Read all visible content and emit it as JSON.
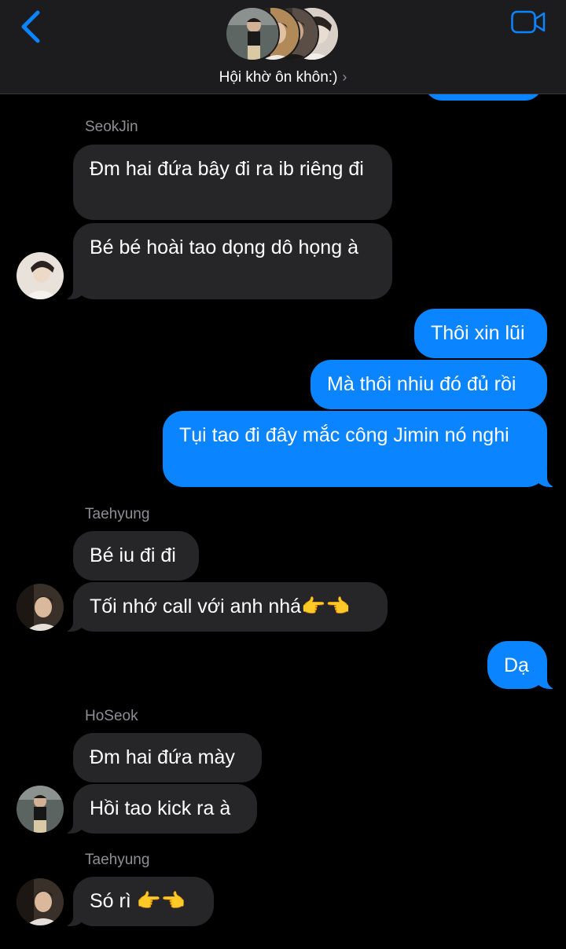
{
  "header": {
    "title": "Hội khờ ôn khôn:)",
    "chevron": "›"
  },
  "icons": {
    "back": "chevron-left-icon",
    "video": "video-camera-icon",
    "accent": "#0a84ff"
  },
  "messages": [
    {
      "sender": "SeokJin",
      "text": "Đm hai đứa bây đi ra ib riêng đi"
    },
    {
      "text": "Bé bé hoài tao dọng dô họng à"
    },
    {
      "text": "Thôi xin lũi"
    },
    {
      "text": "Mà thôi nhiu đó đủ rồi"
    },
    {
      "text": "Tụi tao đi đây mắc công Jimin nó nghi"
    },
    {
      "sender": "Taehyung",
      "text": "Bé iu đi đi"
    },
    {
      "text": "Tối nhớ call với anh nhá👉👈"
    },
    {
      "text": "Dạ"
    },
    {
      "sender": "HoSeok",
      "text": "Đm hai đứa mày"
    },
    {
      "text": "Hồi tao kick ra à"
    },
    {
      "sender": "Taehyung",
      "text": "Só rì 👉👈"
    }
  ]
}
